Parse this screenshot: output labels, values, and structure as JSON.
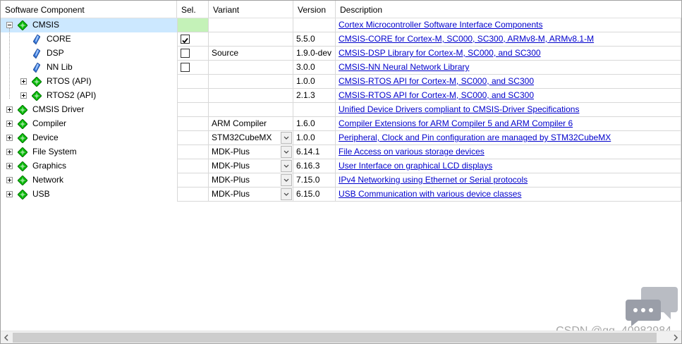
{
  "header": {
    "component": "Software Component",
    "sel": "Sel.",
    "variant": "Variant",
    "version": "Version",
    "description": "Description"
  },
  "rows": [
    {
      "name": "CMSIS",
      "level": 0,
      "expander": "minus",
      "icon": "green-diamond-icon",
      "sel": "green",
      "variant": "",
      "dropdown": false,
      "version": "",
      "description": "Cortex Microcontroller Software Interface Components"
    },
    {
      "name": "CORE",
      "level": 1,
      "expander": "none",
      "icon": "blue-gem-icon",
      "sel": "checked",
      "variant": "",
      "dropdown": false,
      "version": "5.5.0",
      "description": "CMSIS-CORE for Cortex-M, SC000, SC300, ARMv8-M, ARMv8.1-M"
    },
    {
      "name": "DSP",
      "level": 1,
      "expander": "none",
      "icon": "blue-gem-icon",
      "sel": "unchecked",
      "variant": "Source",
      "dropdown": false,
      "version": "1.9.0-dev",
      "description": "CMSIS-DSP Library for Cortex-M, SC000, and SC300"
    },
    {
      "name": "NN Lib",
      "level": 1,
      "expander": "none",
      "icon": "blue-gem-icon",
      "sel": "unchecked",
      "variant": "",
      "dropdown": false,
      "version": "3.0.0",
      "description": "CMSIS-NN Neural Network Library"
    },
    {
      "name": "RTOS (API)",
      "level": 1,
      "expander": "plus",
      "icon": "green-diamond-icon",
      "sel": "none",
      "variant": "",
      "dropdown": false,
      "version": "1.0.0",
      "description": "CMSIS-RTOS API for Cortex-M, SC000, and SC300"
    },
    {
      "name": "RTOS2 (API)",
      "level": 1,
      "expander": "plus",
      "icon": "green-diamond-icon",
      "sel": "none",
      "variant": "",
      "dropdown": false,
      "version": "2.1.3",
      "description": "CMSIS-RTOS API for Cortex-M, SC000, and SC300"
    },
    {
      "name": "CMSIS Driver",
      "level": 0,
      "expander": "plus",
      "icon": "green-diamond-icon",
      "sel": "none",
      "variant": "",
      "dropdown": false,
      "version": "",
      "description": "Unified Device Drivers compliant to CMSIS-Driver Specifications"
    },
    {
      "name": "Compiler",
      "level": 0,
      "expander": "plus",
      "icon": "green-diamond-icon",
      "sel": "none",
      "variant": "ARM Compiler",
      "dropdown": false,
      "version": "1.6.0",
      "description": "Compiler Extensions for ARM Compiler 5 and ARM Compiler 6"
    },
    {
      "name": "Device",
      "level": 0,
      "expander": "plus",
      "icon": "green-diamond-icon",
      "sel": "none",
      "variant": "STM32CubeMX",
      "dropdown": true,
      "version": "1.0.0",
      "description": "Peripheral, Clock and Pin configuration are managed by STM32CubeMX"
    },
    {
      "name": "File System",
      "level": 0,
      "expander": "plus",
      "icon": "green-diamond-icon",
      "sel": "none",
      "variant": "MDK-Plus",
      "dropdown": true,
      "version": "6.14.1",
      "description": "File Access on various storage devices"
    },
    {
      "name": "Graphics",
      "level": 0,
      "expander": "plus",
      "icon": "green-diamond-icon",
      "sel": "none",
      "variant": "MDK-Plus",
      "dropdown": true,
      "version": "6.16.3",
      "description": "User Interface on graphical LCD displays"
    },
    {
      "name": "Network",
      "level": 0,
      "expander": "plus",
      "icon": "green-diamond-icon",
      "sel": "none",
      "variant": "MDK-Plus",
      "dropdown": true,
      "version": "7.15.0",
      "description": "IPv4 Networking using Ethernet or Serial protocols"
    },
    {
      "name": "USB",
      "level": 0,
      "expander": "plus",
      "icon": "green-diamond-icon",
      "sel": "none",
      "variant": "MDK-Plus",
      "dropdown": true,
      "version": "6.15.0",
      "description": "USB Communication with various device classes"
    }
  ],
  "colors": {
    "selected_bg": "#cce8ff",
    "green_sel": "#c4f2b8",
    "link": "#0000cc",
    "diamond": "#00b800"
  },
  "watermark": "CSDN @qq_40982984"
}
